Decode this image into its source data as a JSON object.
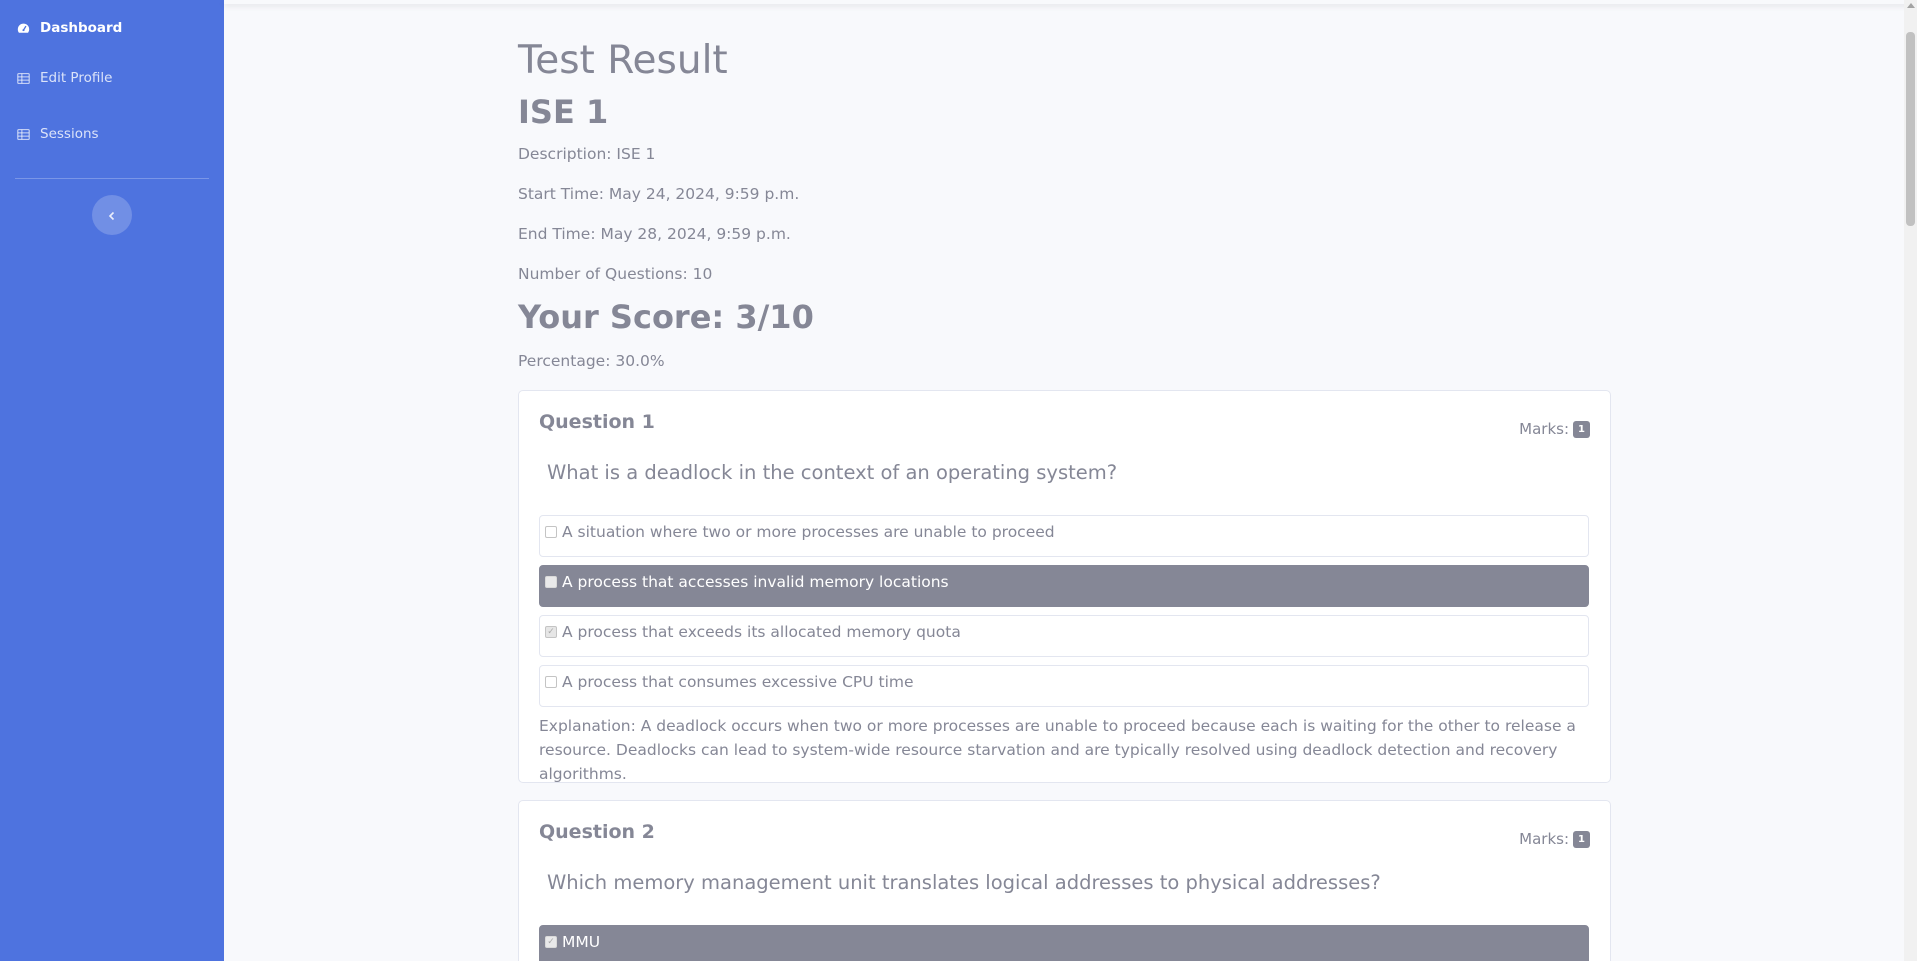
{
  "sidebar": {
    "items": [
      {
        "label": "Dashboard",
        "icon": "tachometer-icon"
      },
      {
        "label": "Edit Profile",
        "icon": "table-icon"
      },
      {
        "label": "Sessions",
        "icon": "table-icon"
      }
    ],
    "toggle_icon": "chevron-left-icon"
  },
  "page": {
    "title": "Test Result",
    "session_name": "ISE 1",
    "description": "Description: ISE 1",
    "start_time": "Start Time: May 24, 2024, 9:59 p.m.",
    "end_time": "End Time: May 28, 2024, 9:59 p.m.",
    "num_questions": "Number of Questions: 10",
    "score": "Your Score: 3/10",
    "percentage": "Percentage: 30.0%"
  },
  "colors": {
    "sidebar": "#4e73df",
    "text": "#858796",
    "selected_option": "#858796",
    "background": "#f8f9fc"
  },
  "questions": [
    {
      "title": "Question 1",
      "marks_label": "Marks:",
      "marks": "1",
      "text": "What is a deadlock in the context of an operating system?",
      "options": [
        {
          "text": "A situation where two or more processes are unable to proceed",
          "checked": false,
          "selected": false
        },
        {
          "text": "A process that accesses invalid memory locations",
          "checked": false,
          "selected": true
        },
        {
          "text": "A process that exceeds its allocated memory quota",
          "checked": true,
          "selected": false
        },
        {
          "text": "A process that consumes excessive CPU time",
          "checked": false,
          "selected": false
        }
      ],
      "explanation": "Explanation: A deadlock occurs when two or more processes are unable to proceed because each is waiting for the other to release a resource. Deadlocks can lead to system-wide resource starvation and are typically resolved using deadlock detection and recovery algorithms."
    },
    {
      "title": "Question 2",
      "marks_label": "Marks:",
      "marks": "1",
      "text": "Which memory management unit translates logical addresses to physical addresses?",
      "options": [
        {
          "text": "MMU",
          "checked": true,
          "selected": true
        }
      ]
    }
  ]
}
